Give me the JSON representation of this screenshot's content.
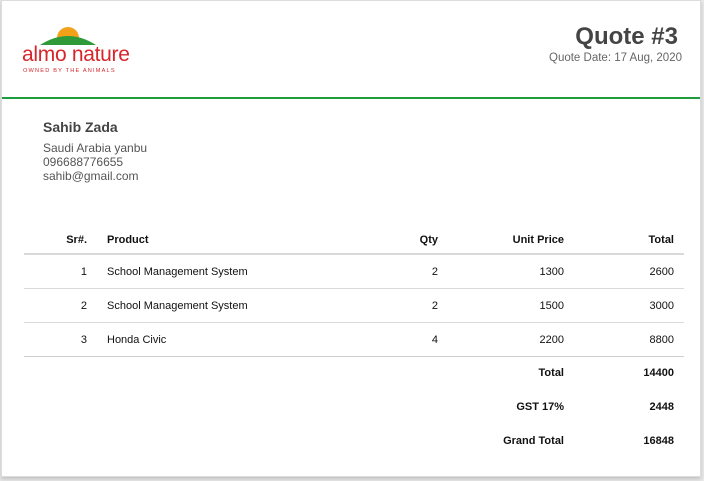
{
  "brand": {
    "name": "almo nature",
    "tagline": "OWNED BY THE ANIMALS",
    "accent_color": "#1f9d3e",
    "logo_red": "#d6262b",
    "logo_orange": "#f2a118",
    "logo_green": "#2f9a3a"
  },
  "quote": {
    "title": "Quote #3",
    "date": "Quote Date: 17 Aug, 2020"
  },
  "customer": {
    "name": "Sahib Zada",
    "address": "Saudi Arabia yanbu",
    "phone": "096688776655",
    "email": "sahib@gmail.com"
  },
  "table": {
    "headers": {
      "sr": "Sr#.",
      "product": "Product",
      "qty": "Qty",
      "unit_price": "Unit Price",
      "total": "Total"
    },
    "rows": [
      {
        "sr": "1",
        "product": "School Management System",
        "qty": "2",
        "unit_price": "1300",
        "total": "2600"
      },
      {
        "sr": "2",
        "product": "School Management System",
        "qty": "2",
        "unit_price": "1500",
        "total": "3000"
      },
      {
        "sr": "3",
        "product": "Honda Civic",
        "qty": "4",
        "unit_price": "2200",
        "total": "8800"
      }
    ]
  },
  "summary": {
    "total_label": "Total",
    "total_value": "14400",
    "gst_label": "GST 17%",
    "gst_value": "2448",
    "grand_total_label": "Grand Total",
    "grand_total_value": "16848"
  }
}
